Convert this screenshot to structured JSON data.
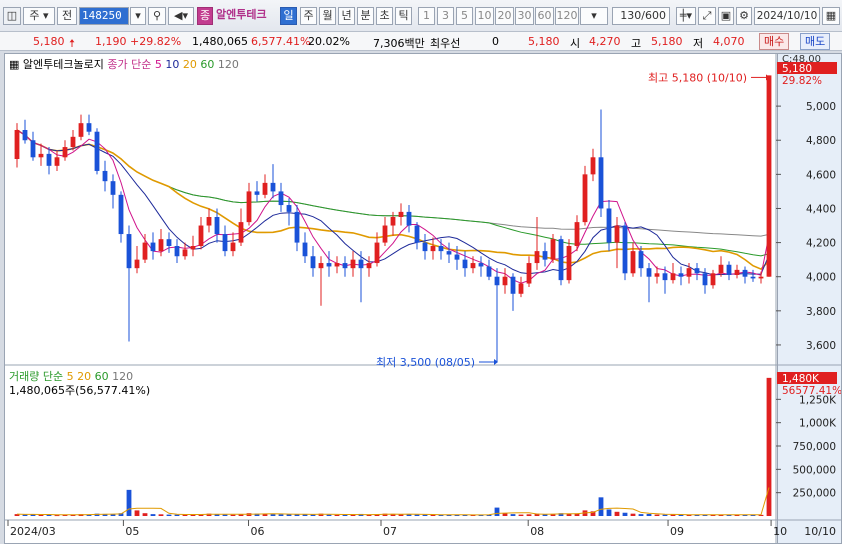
{
  "toolbar": {
    "market": "주",
    "type": "전",
    "code": "148250",
    "name_badge": "종",
    "name": "알엔투테크",
    "periods": [
      "일",
      "주",
      "월",
      "년",
      "분",
      "초",
      "틱"
    ],
    "period_selected": "일",
    "ticks": [
      "1",
      "3",
      "5",
      "10",
      "20",
      "30",
      "60",
      "120"
    ],
    "count": "130/600",
    "date": "2024/10/10"
  },
  "quote": {
    "price": "5,180",
    "change": "1,190",
    "change_pct": "+29.82%",
    "volume": "1,480,065",
    "volume_pct": "6,577.41%",
    "turnover": "20.02%",
    "amount": "7,306백만",
    "priority_label": "최우선",
    "priority_value": "0",
    "last": "5,180",
    "open_label": "시",
    "open": "4,270",
    "high_label": "고",
    "high": "5,180",
    "low_label": "저",
    "low": "4,070",
    "buy": "매수",
    "sell": "매도"
  },
  "price_legend": {
    "name": "알엔투테크놀로지",
    "series": "종가 단순",
    "ma": [
      "5",
      "10",
      "20",
      "60",
      "120"
    ],
    "ma_colors": [
      "#d0148c",
      "#1e2a9a",
      "#e09a00",
      "#2a9a2a",
      "#777777"
    ]
  },
  "volume_legend": {
    "title": "거래량 단순",
    "ma": [
      "5",
      "20",
      "60",
      "120"
    ],
    "info": "1,480,065주(56,577.41%)"
  },
  "annotations": {
    "high": "최고 5,180 (10/10)",
    "low": "최저 3,500 (08/05)"
  },
  "price_axis": {
    "current_label": "C:48.00",
    "current_price": "5,180",
    "current_pct": "29.82%",
    "ticks": [
      "5,000",
      "4,800",
      "4,600",
      "4,400",
      "4,200",
      "4,000",
      "3,800",
      "3,600"
    ]
  },
  "volume_axis": {
    "current": "1,480K",
    "pct": "56577.41%",
    "ticks": [
      "1,250K",
      "1,000K",
      "750,000",
      "500,000",
      "250,000"
    ]
  },
  "date_axis": {
    "labels": [
      "2024/03",
      "05",
      "06",
      "07",
      "08",
      "09",
      "10"
    ],
    "end": "10/10"
  },
  "chart_data": {
    "type": "candlestick",
    "ylim": [
      3500,
      5200
    ],
    "vol_ylim": [
      0,
      1500000
    ],
    "candles": [
      [
        4690,
        4860,
        4640,
        4900
      ],
      [
        4860,
        4800,
        4780,
        4920
      ],
      [
        4800,
        4700,
        4680,
        4850
      ],
      [
        4700,
        4720,
        4650,
        4780
      ],
      [
        4720,
        4650,
        4600,
        4760
      ],
      [
        4650,
        4700,
        4620,
        4740
      ],
      [
        4700,
        4760,
        4680,
        4800
      ],
      [
        4760,
        4820,
        4740,
        4860
      ],
      [
        4820,
        4900,
        4800,
        4950
      ],
      [
        4900,
        4850,
        4830,
        4950
      ],
      [
        4850,
        4620,
        4600,
        4870
      ],
      [
        4620,
        4560,
        4500,
        4680
      ],
      [
        4560,
        4480,
        4400,
        4600
      ],
      [
        4480,
        4250,
        4200,
        4500
      ],
      [
        4250,
        4050,
        3620,
        4300
      ],
      [
        4050,
        4100,
        4020,
        4180
      ],
      [
        4100,
        4200,
        4080,
        4250
      ],
      [
        4200,
        4150,
        4100,
        4260
      ],
      [
        4150,
        4220,
        4120,
        4280
      ],
      [
        4220,
        4180,
        4140,
        4260
      ],
      [
        4180,
        4120,
        4080,
        4220
      ],
      [
        4120,
        4160,
        4100,
        4200
      ],
      [
        4160,
        4180,
        4120,
        4240
      ],
      [
        4180,
        4300,
        4160,
        4350
      ],
      [
        4300,
        4350,
        4260,
        4400
      ],
      [
        4350,
        4250,
        4200,
        4400
      ],
      [
        4250,
        4150,
        4120,
        4300
      ],
      [
        4150,
        4200,
        4120,
        4260
      ],
      [
        4200,
        4320,
        4180,
        4400
      ],
      [
        4320,
        4500,
        4300,
        4550
      ],
      [
        4500,
        4480,
        4440,
        4560
      ],
      [
        4480,
        4550,
        4460,
        4600
      ],
      [
        4550,
        4500,
        4460,
        4660
      ],
      [
        4500,
        4420,
        4380,
        4550
      ],
      [
        4420,
        4380,
        4300,
        4460
      ],
      [
        4380,
        4200,
        4150,
        4420
      ],
      [
        4200,
        4120,
        4080,
        4260
      ],
      [
        4120,
        4050,
        4000,
        4180
      ],
      [
        4050,
        4080,
        3830,
        4120
      ],
      [
        4080,
        4060,
        4000,
        4150
      ],
      [
        4060,
        4080,
        4020,
        4120
      ],
      [
        4080,
        4050,
        4000,
        4120
      ],
      [
        4050,
        4100,
        4000,
        4150
      ],
      [
        4100,
        4050,
        3850,
        4150
      ],
      [
        4050,
        4080,
        4000,
        4120
      ],
      [
        4080,
        4200,
        4060,
        4260
      ],
      [
        4200,
        4300,
        4180,
        4350
      ],
      [
        4300,
        4350,
        4240,
        4380
      ],
      [
        4350,
        4380,
        4300,
        4430
      ],
      [
        4380,
        4300,
        4260,
        4420
      ],
      [
        4300,
        4200,
        4160,
        4320
      ],
      [
        4200,
        4150,
        4100,
        4250
      ],
      [
        4150,
        4180,
        4100,
        4230
      ],
      [
        4180,
        4150,
        4100,
        4220
      ],
      [
        4150,
        4130,
        4080,
        4200
      ],
      [
        4130,
        4100,
        4040,
        4180
      ],
      [
        4100,
        4050,
        4000,
        4150
      ],
      [
        4050,
        4080,
        4020,
        4120
      ],
      [
        4080,
        4060,
        4000,
        4120
      ],
      [
        4060,
        4000,
        3980,
        4100
      ],
      [
        4000,
        3950,
        3500,
        4050
      ],
      [
        3950,
        4000,
        3900,
        4050
      ],
      [
        4000,
        3900,
        3800,
        4020
      ],
      [
        3900,
        3960,
        3880,
        4000
      ],
      [
        3960,
        4080,
        3940,
        4120
      ],
      [
        4080,
        4150,
        4040,
        4350
      ],
      [
        4150,
        4100,
        4060,
        4200
      ],
      [
        4100,
        4220,
        4080,
        4250
      ],
      [
        4220,
        3980,
        3950,
        4240
      ],
      [
        3980,
        4180,
        3960,
        4220
      ],
      [
        4180,
        4320,
        4150,
        4360
      ],
      [
        4320,
        4600,
        4300,
        4650
      ],
      [
        4600,
        4700,
        4560,
        4750
      ],
      [
        4700,
        4400,
        4350,
        4980
      ],
      [
        4400,
        4200,
        4150,
        4450
      ],
      [
        4200,
        4300,
        4050,
        4350
      ],
      [
        4300,
        4020,
        3980,
        4320
      ],
      [
        4020,
        4150,
        4000,
        4200
      ],
      [
        4150,
        4050,
        4000,
        4180
      ],
      [
        4050,
        4000,
        3850,
        4080
      ],
      [
        4000,
        4020,
        3960,
        4060
      ],
      [
        4020,
        3980,
        3900,
        4060
      ],
      [
        3980,
        4020,
        3960,
        4080
      ],
      [
        4020,
        4000,
        3950,
        4060
      ],
      [
        4000,
        4050,
        3960,
        4080
      ],
      [
        4050,
        4020,
        3980,
        4080
      ],
      [
        4020,
        3950,
        3900,
        4050
      ],
      [
        3950,
        4020,
        3930,
        4040
      ],
      [
        4020,
        4070,
        4000,
        4120
      ],
      [
        4070,
        4010,
        3980,
        4090
      ],
      [
        4010,
        4040,
        3990,
        4070
      ],
      [
        4040,
        4000,
        3960,
        4060
      ],
      [
        4000,
        3990,
        3970,
        4040
      ],
      [
        3990,
        4000,
        3960,
        4030
      ],
      [
        4000,
        5180,
        4000,
        5180
      ]
    ],
    "volumes": [
      20000,
      15000,
      18000,
      12000,
      14000,
      10000,
      12000,
      16000,
      20000,
      15000,
      25000,
      22000,
      20000,
      30000,
      280000,
      60000,
      30000,
      20000,
      18000,
      15000,
      14000,
      16000,
      15000,
      20000,
      25000,
      18000,
      15000,
      14000,
      20000,
      30000,
      25000,
      22000,
      20000,
      18000,
      16000,
      20000,
      18000,
      15000,
      25000,
      14000,
      12000,
      13000,
      14000,
      22000,
      13000,
      18000,
      25000,
      22000,
      20000,
      16000,
      15000,
      14000,
      13000,
      12000,
      12000,
      13000,
      12000,
      11000,
      12000,
      15000,
      90000,
      30000,
      20000,
      15000,
      18000,
      25000,
      20000,
      22000,
      30000,
      25000,
      28000,
      60000,
      50000,
      200000,
      70000,
      45000,
      35000,
      25000,
      20000,
      22000,
      15000,
      14000,
      15000,
      13000,
      14000,
      13000,
      14000,
      12000,
      13000,
      15000,
      12000,
      13000,
      12000,
      12000,
      1480065
    ]
  }
}
